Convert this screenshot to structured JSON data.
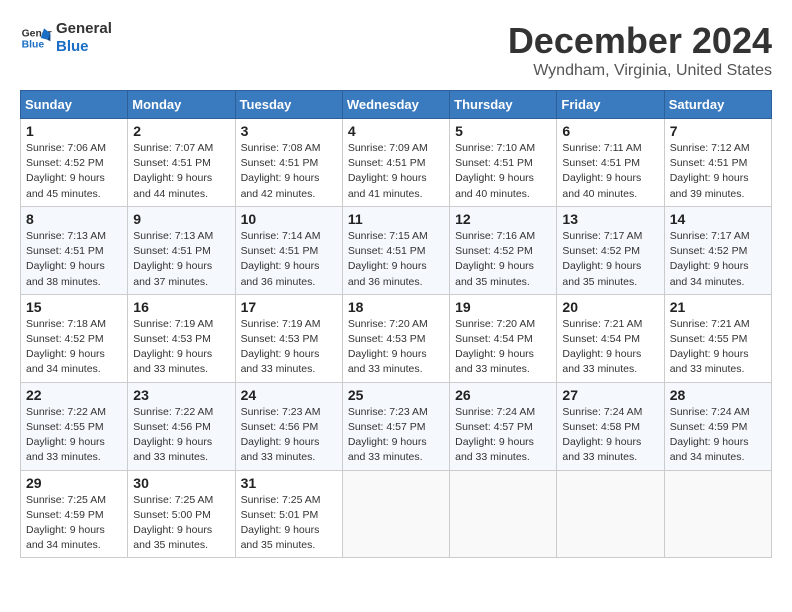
{
  "logo": {
    "line1": "General",
    "line2": "Blue"
  },
  "title": "December 2024",
  "subtitle": "Wyndham, Virginia, United States",
  "days_header": [
    "Sunday",
    "Monday",
    "Tuesday",
    "Wednesday",
    "Thursday",
    "Friday",
    "Saturday"
  ],
  "weeks": [
    [
      {
        "day": "1",
        "sunrise": "7:06 AM",
        "sunset": "4:52 PM",
        "daylight": "9 hours and 45 minutes."
      },
      {
        "day": "2",
        "sunrise": "7:07 AM",
        "sunset": "4:51 PM",
        "daylight": "9 hours and 44 minutes."
      },
      {
        "day": "3",
        "sunrise": "7:08 AM",
        "sunset": "4:51 PM",
        "daylight": "9 hours and 42 minutes."
      },
      {
        "day": "4",
        "sunrise": "7:09 AM",
        "sunset": "4:51 PM",
        "daylight": "9 hours and 41 minutes."
      },
      {
        "day": "5",
        "sunrise": "7:10 AM",
        "sunset": "4:51 PM",
        "daylight": "9 hours and 40 minutes."
      },
      {
        "day": "6",
        "sunrise": "7:11 AM",
        "sunset": "4:51 PM",
        "daylight": "9 hours and 40 minutes."
      },
      {
        "day": "7",
        "sunrise": "7:12 AM",
        "sunset": "4:51 PM",
        "daylight": "9 hours and 39 minutes."
      }
    ],
    [
      {
        "day": "8",
        "sunrise": "7:13 AM",
        "sunset": "4:51 PM",
        "daylight": "9 hours and 38 minutes."
      },
      {
        "day": "9",
        "sunrise": "7:13 AM",
        "sunset": "4:51 PM",
        "daylight": "9 hours and 37 minutes."
      },
      {
        "day": "10",
        "sunrise": "7:14 AM",
        "sunset": "4:51 PM",
        "daylight": "9 hours and 36 minutes."
      },
      {
        "day": "11",
        "sunrise": "7:15 AM",
        "sunset": "4:51 PM",
        "daylight": "9 hours and 36 minutes."
      },
      {
        "day": "12",
        "sunrise": "7:16 AM",
        "sunset": "4:52 PM",
        "daylight": "9 hours and 35 minutes."
      },
      {
        "day": "13",
        "sunrise": "7:17 AM",
        "sunset": "4:52 PM",
        "daylight": "9 hours and 35 minutes."
      },
      {
        "day": "14",
        "sunrise": "7:17 AM",
        "sunset": "4:52 PM",
        "daylight": "9 hours and 34 minutes."
      }
    ],
    [
      {
        "day": "15",
        "sunrise": "7:18 AM",
        "sunset": "4:52 PM",
        "daylight": "9 hours and 34 minutes."
      },
      {
        "day": "16",
        "sunrise": "7:19 AM",
        "sunset": "4:53 PM",
        "daylight": "9 hours and 33 minutes."
      },
      {
        "day": "17",
        "sunrise": "7:19 AM",
        "sunset": "4:53 PM",
        "daylight": "9 hours and 33 minutes."
      },
      {
        "day": "18",
        "sunrise": "7:20 AM",
        "sunset": "4:53 PM",
        "daylight": "9 hours and 33 minutes."
      },
      {
        "day": "19",
        "sunrise": "7:20 AM",
        "sunset": "4:54 PM",
        "daylight": "9 hours and 33 minutes."
      },
      {
        "day": "20",
        "sunrise": "7:21 AM",
        "sunset": "4:54 PM",
        "daylight": "9 hours and 33 minutes."
      },
      {
        "day": "21",
        "sunrise": "7:21 AM",
        "sunset": "4:55 PM",
        "daylight": "9 hours and 33 minutes."
      }
    ],
    [
      {
        "day": "22",
        "sunrise": "7:22 AM",
        "sunset": "4:55 PM",
        "daylight": "9 hours and 33 minutes."
      },
      {
        "day": "23",
        "sunrise": "7:22 AM",
        "sunset": "4:56 PM",
        "daylight": "9 hours and 33 minutes."
      },
      {
        "day": "24",
        "sunrise": "7:23 AM",
        "sunset": "4:56 PM",
        "daylight": "9 hours and 33 minutes."
      },
      {
        "day": "25",
        "sunrise": "7:23 AM",
        "sunset": "4:57 PM",
        "daylight": "9 hours and 33 minutes."
      },
      {
        "day": "26",
        "sunrise": "7:24 AM",
        "sunset": "4:57 PM",
        "daylight": "9 hours and 33 minutes."
      },
      {
        "day": "27",
        "sunrise": "7:24 AM",
        "sunset": "4:58 PM",
        "daylight": "9 hours and 33 minutes."
      },
      {
        "day": "28",
        "sunrise": "7:24 AM",
        "sunset": "4:59 PM",
        "daylight": "9 hours and 34 minutes."
      }
    ],
    [
      {
        "day": "29",
        "sunrise": "7:25 AM",
        "sunset": "4:59 PM",
        "daylight": "9 hours and 34 minutes."
      },
      {
        "day": "30",
        "sunrise": "7:25 AM",
        "sunset": "5:00 PM",
        "daylight": "9 hours and 35 minutes."
      },
      {
        "day": "31",
        "sunrise": "7:25 AM",
        "sunset": "5:01 PM",
        "daylight": "9 hours and 35 minutes."
      },
      null,
      null,
      null,
      null
    ]
  ],
  "labels": {
    "sunrise_prefix": "Sunrise: ",
    "sunset_prefix": "Sunset: ",
    "daylight_prefix": "Daylight: "
  }
}
